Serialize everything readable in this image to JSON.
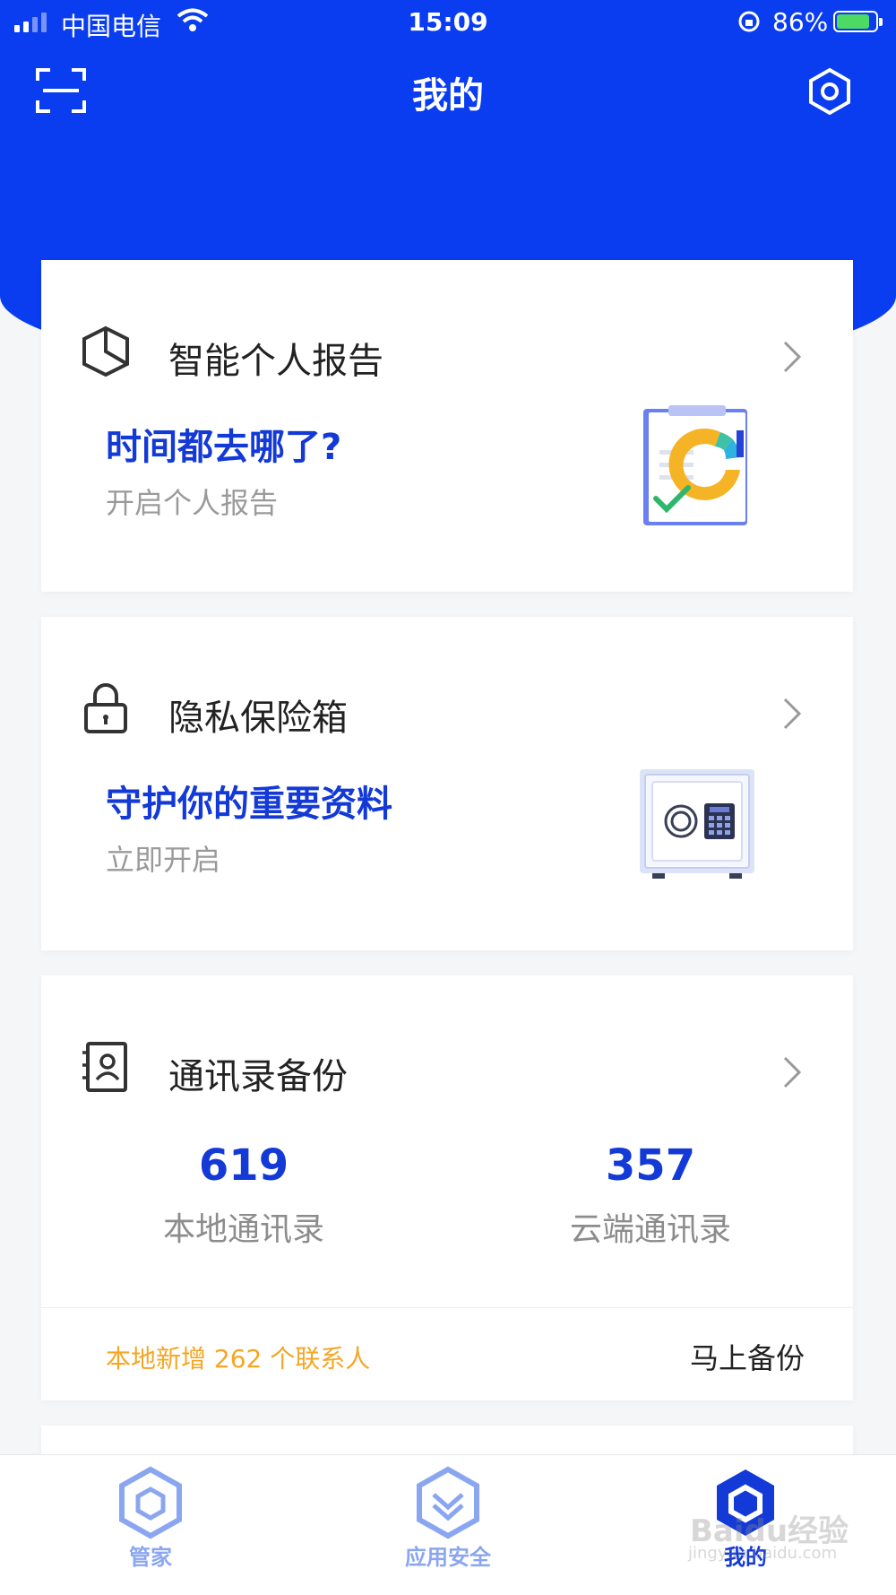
{
  "status_bar": {
    "carrier": "中国电信",
    "time": "15:09",
    "battery_percent": "86%",
    "battery_level": 0.86
  },
  "nav": {
    "title": "我的",
    "scan_icon": "scan-icon",
    "settings_icon": "settings-hexagon-icon"
  },
  "report_card": {
    "title": "智能个人报告",
    "headline": "时间都去哪了?",
    "subtitle": "开启个人报告",
    "icon": "report-cube-icon"
  },
  "vault_card": {
    "title": "隐私保险箱",
    "headline": "守护你的重要资料",
    "subtitle": "立即开启",
    "icon": "lock-icon"
  },
  "contacts_card": {
    "title": "通讯录备份",
    "local_count": "619",
    "local_label": "本地通讯录",
    "cloud_count": "357",
    "cloud_label": "云端通讯录",
    "notice": "本地新增 262 个联系人",
    "backup_button": "马上备份",
    "icon": "contacts-book-icon"
  },
  "tabbar": {
    "tabs": [
      {
        "label": "管家",
        "icon": "manager-hexagon-icon",
        "active": false
      },
      {
        "label": "应用安全",
        "icon": "app-security-hexagon-icon",
        "active": false
      },
      {
        "label": "我的",
        "icon": "profile-hexagon-icon",
        "active": true
      }
    ]
  },
  "watermark": {
    "text": "Baidu经验",
    "url_text": "jingyan.baidu.com"
  },
  "colors": {
    "brand_blue": "#0a3cf0",
    "headline_blue": "#1339d6",
    "notice_orange": "#f5a623",
    "tab_inactive": "#8aa6f0"
  }
}
